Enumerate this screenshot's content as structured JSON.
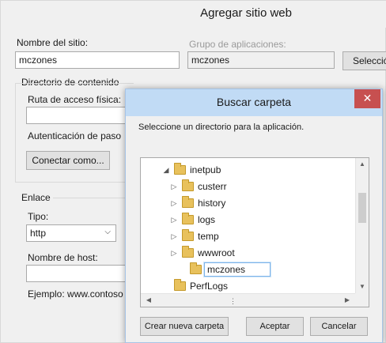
{
  "outer": {
    "title": "Agregar sitio web",
    "site_name_label": "Nombre del sitio:",
    "site_name_value": "mczones",
    "app_pool_label": "Grupo de aplicaciones:",
    "app_pool_value": "mczones",
    "select_button": "Selecció",
    "content_dir_label": "Directorio de contenido",
    "physical_path_label": "Ruta de acceso física:",
    "physical_path_value": "",
    "pass_through_label": "Autenticación de paso",
    "connect_as_button": "Conectar como...",
    "binding_label": "Enlace",
    "type_label": "Tipo:",
    "type_value": "http",
    "host_name_label": "Nombre de host:",
    "host_name_value": "",
    "example_text": "Ejemplo: www.contoso"
  },
  "dialog": {
    "title": "Buscar carpeta",
    "close_label": "✕",
    "instruction": "Seleccione un directorio para la aplicación.",
    "tree": [
      {
        "label": "inetpub",
        "expanded": true
      },
      {
        "label": "custerr",
        "expanded": false
      },
      {
        "label": "history",
        "expanded": false
      },
      {
        "label": "logs",
        "expanded": false
      },
      {
        "label": "temp",
        "expanded": false
      },
      {
        "label": "wwwroot",
        "expanded": false
      },
      {
        "label": "mczones",
        "editing": true
      },
      {
        "label": "PerfLogs",
        "expanded": false
      }
    ],
    "new_folder_button": "Crear nueva carpeta",
    "ok_button": "Aceptar",
    "cancel_button": "Cancelar"
  },
  "icons": {
    "expanded": "triangle-down-icon",
    "collapsed": "triangle-right-icon",
    "folder": "folder-icon",
    "close": "close-icon",
    "dropdown": "chevron-down-icon"
  },
  "colors": {
    "window_bg": "#f0f0f0",
    "dialog_titlebar": "#c1dbf5",
    "close_button": "#c75050",
    "folder": "#e8c15c",
    "edit_border": "#7eb4ea"
  }
}
